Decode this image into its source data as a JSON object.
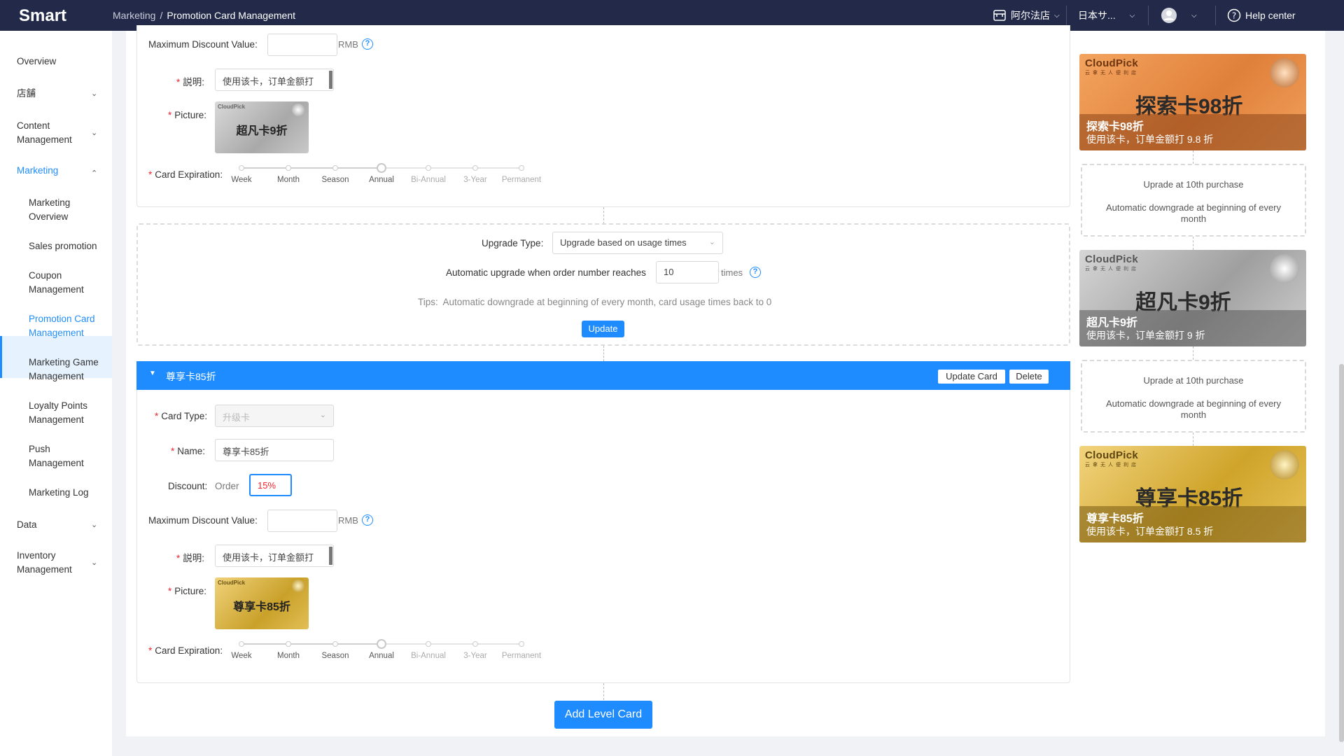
{
  "app": {
    "logo": "Smart"
  },
  "breadcrumb": {
    "parent": "Marketing",
    "separator": "/",
    "current": "Promotion Card Management"
  },
  "topbar": {
    "store": "阿尔法店",
    "region": "日本サ...",
    "help": "Help center"
  },
  "sidebar": {
    "items": [
      {
        "label": "Overview"
      },
      {
        "label": "店舗"
      },
      {
        "label": "Content Management"
      },
      {
        "label": "Marketing"
      },
      {
        "label": "Marketing Overview"
      },
      {
        "label": "Sales promotion"
      },
      {
        "label": "Coupon Management"
      },
      {
        "label": "Promotion Card Management"
      },
      {
        "label": "Marketing Game Management"
      },
      {
        "label": "Loyalty Points Management"
      },
      {
        "label": "Push Management"
      },
      {
        "label": "Marketing Log"
      },
      {
        "label": "Data"
      },
      {
        "label": "Inventory Management"
      }
    ]
  },
  "card1": {
    "max_discount_label": "Maximum Discount Value",
    "max_discount_value": "",
    "unit": "RMB",
    "desc_label": "説明",
    "desc_value": "使用该卡，订单金额打",
    "picture_label": "Picture",
    "picture_brand": "CloudPick",
    "picture_text": "超凡卡9折",
    "expiration_label": "Card Expiration",
    "expiration_selected": "Annual"
  },
  "upgrade": {
    "type_label": "Upgrade Type",
    "type_value": "Upgrade based on usage times",
    "auto_label": "Automatic upgrade when order number reaches",
    "auto_value": "10",
    "auto_unit": "times",
    "tips_label": "Tips",
    "tips_text": "Automatic downgrade at beginning of every month, card usage times back to 0",
    "update_button": "Update"
  },
  "card2": {
    "header": "尊享卡85折",
    "update_card_button": "Update Card",
    "delete_button": "Delete",
    "type_label": "Card Type",
    "type_value": "升级卡",
    "name_label": "Name",
    "name_value": "尊享卡85折",
    "discount_label": "Discount",
    "discount_prefix": "Order",
    "discount_value": "15%",
    "max_discount_label": "Maximum Discount Value",
    "max_discount_value": "",
    "unit": "RMB",
    "desc_label": "説明",
    "desc_value": "使用该卡，订单金额打",
    "picture_label": "Picture",
    "picture_brand": "CloudPick",
    "picture_text": "尊享卡85折",
    "expiration_label": "Card Expiration",
    "expiration_selected": "Annual"
  },
  "expiration_options": [
    "Week",
    "Month",
    "Season",
    "Annual",
    "Bi-Annual",
    "3-Year",
    "Permanent"
  ],
  "add_level_button": "Add Level Card",
  "preview": {
    "cards": [
      {
        "brand": "CloudPick",
        "sub": "云拿无人便利店",
        "big": "探索卡98折",
        "name": "探索卡98折",
        "desc": "使用该卡，订单金额打 9.8 折"
      },
      {
        "brand": "CloudPick",
        "sub": "云拿无人便利店",
        "big": "超凡卡9折",
        "name": "超凡卡9折",
        "desc": "使用该卡，订单金额打 9 折"
      },
      {
        "brand": "CloudPick",
        "sub": "云拿无人便利店",
        "big": "尊享卡85折",
        "name": "尊享卡85折",
        "desc": "使用该卡，订单金额打 8.5 折"
      }
    ],
    "rules": [
      {
        "upgrade": "Uprade at 10th purchase",
        "downgrade": "Automatic downgrade at beginning of every month"
      },
      {
        "upgrade": "Uprade at 10th purchase",
        "downgrade": "Automatic downgrade at beginning of every month"
      }
    ]
  },
  "colors": {
    "topbar": "#232a49",
    "accent": "#1e8cff",
    "required": "#f5222d",
    "bronze": "#e8914a",
    "silver": "#b8b8b8",
    "gold": "#d9a928"
  },
  "icons": [
    "store-icon",
    "user-icon",
    "help-icon",
    "chevron-down-icon",
    "chevron-up-icon",
    "question-icon",
    "caret-down-icon",
    "medal-icon"
  ]
}
